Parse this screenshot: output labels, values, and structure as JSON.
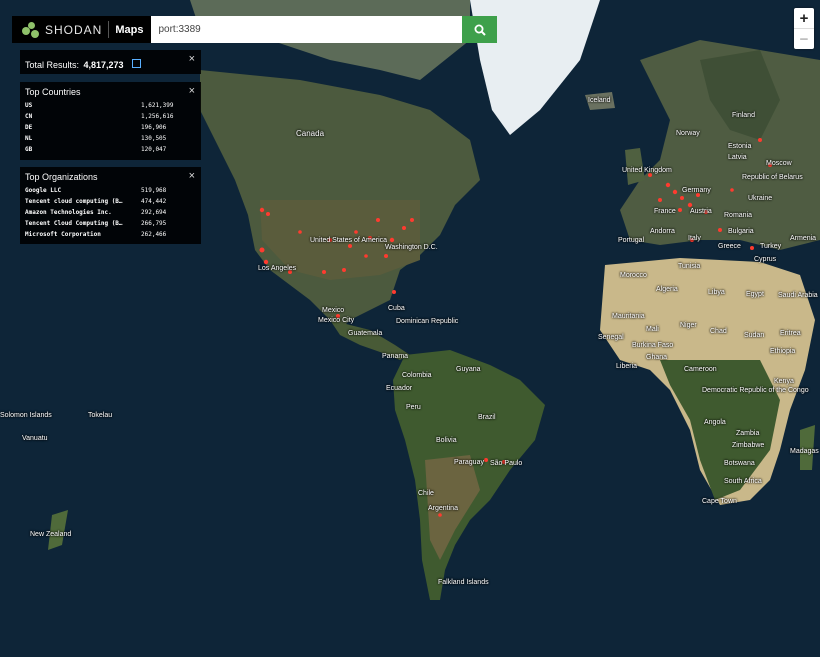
{
  "header": {
    "brand": "SHODAN",
    "section": "Maps",
    "search_value": "port:3389",
    "search_icon": "search-icon",
    "accent_color": "#3ea04b"
  },
  "zoom": {
    "in_label": "+",
    "out_label": "−"
  },
  "total_results": {
    "label": "Total Results:",
    "value": "4,817,273",
    "icon": "external-link-icon"
  },
  "top_countries": {
    "title": "Top Countries",
    "rows": [
      {
        "name": "US",
        "value": "1,621,399"
      },
      {
        "name": "CN",
        "value": "1,256,616"
      },
      {
        "name": "DE",
        "value": "196,906"
      },
      {
        "name": "NL",
        "value": "130,505"
      },
      {
        "name": "GB",
        "value": "120,047"
      }
    ]
  },
  "top_organizations": {
    "title": "Top Organizations",
    "rows": [
      {
        "name": "Google LLC",
        "value": "519,968"
      },
      {
        "name": "Tencent cloud computing (Beijing) Co., Ltd.",
        "value": "474,442"
      },
      {
        "name": "Amazon Technologies Inc.",
        "value": "292,694"
      },
      {
        "name": "Tencent Cloud Computing (Beijing) Co., Ltd",
        "value": "266,795"
      },
      {
        "name": "Microsoft Corporation",
        "value": "262,466"
      }
    ]
  },
  "map_labels": [
    "Iceland",
    "Finland",
    "Norway",
    "Estonia",
    "Latvia",
    "Moscow",
    "United Kingdom",
    "Republic of Belarus",
    "Germany",
    "Ukraine",
    "France",
    "Austria",
    "Romania",
    "Andorra",
    "Italy",
    "Bulgaria",
    "Portugal",
    "Greece",
    "Turkey",
    "Armenia",
    "Cyprus",
    "Tunisia",
    "Morocco",
    "Algeria",
    "Libya",
    "Egypt",
    "Saudi Arabia",
    "Mauritania",
    "Mali",
    "Niger",
    "Chad",
    "Sudan",
    "Eritrea",
    "Senegal",
    "Burkina Faso",
    "Ghana",
    "Liberia",
    "Ethiopia",
    "Cameroon",
    "Democratic Republic of the Congo",
    "Kenya",
    "Angola",
    "Zambia",
    "Zimbabwe",
    "Madagas",
    "Botswana",
    "South Africa",
    "Cape Town",
    "Canada",
    "United States of America",
    "Washington D.C.",
    "Los Angeles",
    "Mexico",
    "Mexico City",
    "Cuba",
    "Dominican Republic",
    "Guatemala",
    "Panama",
    "Colombia",
    "Guyana",
    "Ecuador",
    "Peru",
    "Brazil",
    "Bolivia",
    "Paraguay",
    "São Paulo",
    "Chile",
    "Argentina",
    "Falkland Islands",
    "Solomon Islands",
    "Tokelau",
    "Vanuatu",
    "New Zealand"
  ]
}
